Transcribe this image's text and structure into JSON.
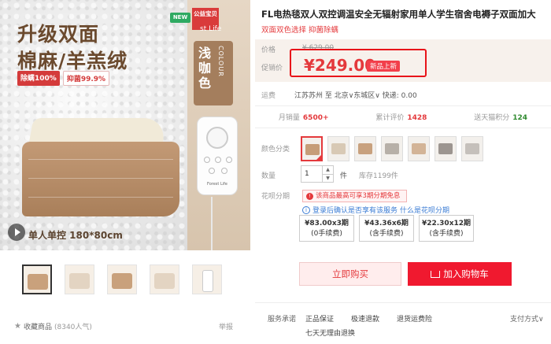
{
  "gallery": {
    "headline_line1": "升级双面",
    "headline_line2": "棉麻/羊羔绒",
    "badge_mite": "除螨100%",
    "badge_bacteria": "抑菌99.9%",
    "new_tag": "NEW",
    "gongyi_tag": "公益宝贝",
    "corner_brand": "st Life",
    "color_name_cn": "浅咖色",
    "color_name_en": "COLOUR",
    "remote_brand": "Forest Life",
    "caption": "单人单控 180*80cm",
    "thumbnails": [
      "thumb-1",
      "thumb-2",
      "thumb-3",
      "thumb-4",
      "thumb-5"
    ],
    "favorite_label": "收藏商品",
    "favorite_count": "(8340人气)",
    "report_label": "举报"
  },
  "product": {
    "title": "FL电热毯双人双控调温安全无辐射家用单人学生宿舍电褥子双面加大",
    "subtitle": "双面双色选择 抑菌除螨"
  },
  "price": {
    "orig_label": "价格",
    "orig_value": "¥ 629.00",
    "promo_label": "促销价",
    "current_value": "¥249.00",
    "tag": "新品上新"
  },
  "shipping": {
    "label": "运费",
    "text": "江苏苏州 至 北京∨东城区∨ 快递: 0.00"
  },
  "stats": {
    "monthly_label": "月销量",
    "monthly_value": "6500+",
    "reviews_label": "累计评价",
    "reviews_value": "1428",
    "points_label": "送天猫积分",
    "points_value": "124"
  },
  "options": {
    "color_label": "颜色分类",
    "qty_label": "数量",
    "qty_value": "1",
    "qty_unit": "件",
    "stock": "库存1199件",
    "huabei_label": "花呗分期",
    "huabei_promo": "该商品最高可享3期分期免息",
    "huabei_login": "登录后确认是否享有该服务",
    "huabei_link": "什么是花呗分期",
    "plans": [
      {
        "amount": "¥83.00x3期",
        "fee": "(0手续费)"
      },
      {
        "amount": "¥43.36x6期",
        "fee": "(含手续费)"
      },
      {
        "amount": "¥22.30x12期",
        "fee": "(含手续费)"
      }
    ]
  },
  "actions": {
    "buy_now": "立即购买",
    "add_cart": "加入购物车"
  },
  "service": {
    "label": "服务承诺",
    "items": [
      "正品保证",
      "极速退款",
      "退货运费险"
    ],
    "item_second_line": "七天无理由退换",
    "pay_label": "支付方式∨"
  },
  "colors": {
    "accent": "#e4393c",
    "cart_button": "#f0192f",
    "price_bg": "#f7f1ec"
  }
}
